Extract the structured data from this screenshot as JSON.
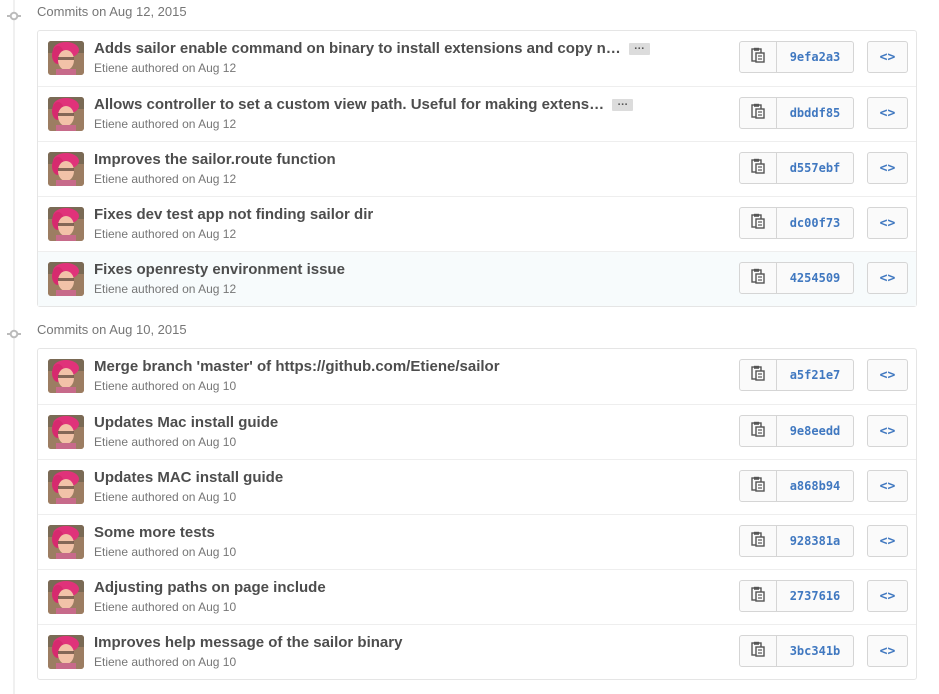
{
  "groups": [
    {
      "header": "Commits on Aug 12, 2015",
      "commits": [
        {
          "message": "Adds sailor enable command on binary to install extensions and copy n…",
          "has_more": true,
          "more_label": "…",
          "meta": "Etiene authored on Aug 12",
          "sha": "9efa2a3",
          "highlight": false
        },
        {
          "message": "Allows controller to set a custom view path. Useful for making extens…",
          "has_more": true,
          "more_label": "…",
          "meta": "Etiene authored on Aug 12",
          "sha": "dbddf85",
          "highlight": false
        },
        {
          "message": "Improves the sailor.route function",
          "has_more": false,
          "meta": "Etiene authored on Aug 12",
          "sha": "d557ebf",
          "highlight": false
        },
        {
          "message": "Fixes dev test app not finding sailor dir",
          "has_more": false,
          "meta": "Etiene authored on Aug 12",
          "sha": "dc00f73",
          "highlight": false
        },
        {
          "message": "Fixes openresty environment issue",
          "has_more": false,
          "meta": "Etiene authored on Aug 12",
          "sha": "4254509",
          "highlight": true
        }
      ]
    },
    {
      "header": "Commits on Aug 10, 2015",
      "commits": [
        {
          "message": "Merge branch 'master' of https://github.com/Etiene/sailor",
          "has_more": false,
          "meta": "Etiene authored on Aug 10",
          "sha": "a5f21e7",
          "highlight": false
        },
        {
          "message": "Updates Mac install guide",
          "has_more": false,
          "meta": "Etiene authored on Aug 10",
          "sha": "9e8eedd",
          "highlight": false
        },
        {
          "message": "Updates MAC install guide",
          "has_more": false,
          "meta": "Etiene authored on Aug 10",
          "sha": "a868b94",
          "highlight": false
        },
        {
          "message": "Some more tests",
          "has_more": false,
          "meta": "Etiene authored on Aug 10",
          "sha": "928381a",
          "highlight": false
        },
        {
          "message": "Adjusting paths on page include",
          "has_more": false,
          "meta": "Etiene authored on Aug 10",
          "sha": "2737616",
          "highlight": false
        },
        {
          "message": "Improves help message of the sailor binary",
          "has_more": false,
          "meta": "Etiene authored on Aug 10",
          "sha": "3bc341b",
          "highlight": false
        }
      ]
    }
  ],
  "browse_label": "<>",
  "icons": {
    "copy": "clipboard-icon",
    "commit_dot": "git-commit-icon",
    "avatar": "avatar"
  },
  "colors": {
    "link": "#4078c0",
    "title": "#4d4d4d",
    "meta": "#767676",
    "highlight_row": "#f7fbfc"
  }
}
